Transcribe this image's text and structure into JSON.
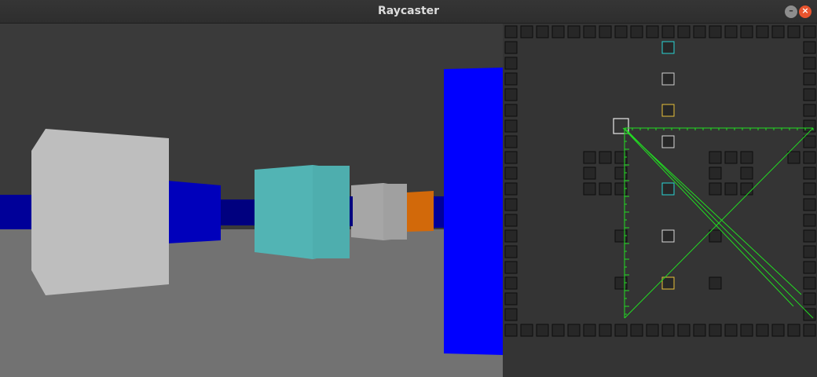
{
  "window": {
    "title": "Raycaster",
    "minimize_glyph": "–",
    "close_glyph": "×"
  },
  "colors": {
    "ceiling": "#3a3a3a",
    "floor": "#727272",
    "wall_blue_dark": "#000099",
    "wall_blue": "#0000cc",
    "wall_blue_bright": "#0000ff",
    "wall_white": "#bfbfbf",
    "wall_cyan": "#52b4b4",
    "wall_gray": "#a8a8a8",
    "wall_orange": "#d2690a",
    "ray": "#22dd22",
    "map_wall": "#111111"
  },
  "minimap": {
    "grid_size": 20,
    "player_tile": [
      7,
      6
    ]
  }
}
